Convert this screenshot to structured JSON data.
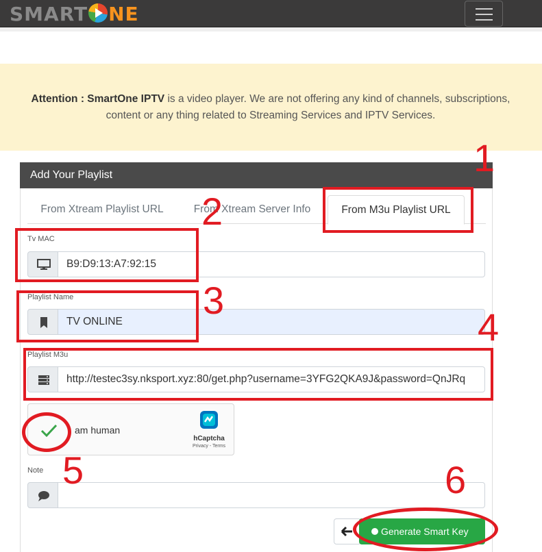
{
  "brand": {
    "logo_left": "SMART",
    "logo_right": "NE"
  },
  "banner": {
    "bold": "Attention : SmartOne IPTV",
    "text": " is a video player. We are not offering any kind of channels, subscriptions, content or any thing related to Streaming Services and IPTV Services."
  },
  "card": {
    "title": "Add Your Playlist"
  },
  "tabs": [
    {
      "label": "From Xtream Playlist URL",
      "active": false
    },
    {
      "label": "From Xtream Server Info",
      "active": false
    },
    {
      "label": "From M3u Playlist URL",
      "active": true
    }
  ],
  "form": {
    "mac": {
      "label": "Tv MAC",
      "value": "B9:D9:13:A7:92:15",
      "icon": "tv-icon"
    },
    "name": {
      "label": "Playlist Name",
      "value": "TV ONLINE",
      "icon": "bookmark-icon"
    },
    "m3u": {
      "label": "Playlist M3u",
      "value": "http://testec3sy.nksport.xyz:80/get.php?username=3YFG2QKA9J&password=QnJRq",
      "icon": "server-icon"
    },
    "note": {
      "label": "Note",
      "value": "",
      "icon": "comment-icon"
    }
  },
  "captcha": {
    "text": "am human",
    "brand": "hCaptcha",
    "links": "Privacy - Terms"
  },
  "buttons": {
    "back": "←",
    "generate": "Generate Smart Key"
  },
  "annotations": [
    "1",
    "2",
    "3",
    "4",
    "5",
    "6"
  ],
  "colors": {
    "annotation": "#e11b22",
    "generate_button": "#28a745",
    "banner": "#fdf3cf",
    "navbar": "#3b3a3a"
  }
}
